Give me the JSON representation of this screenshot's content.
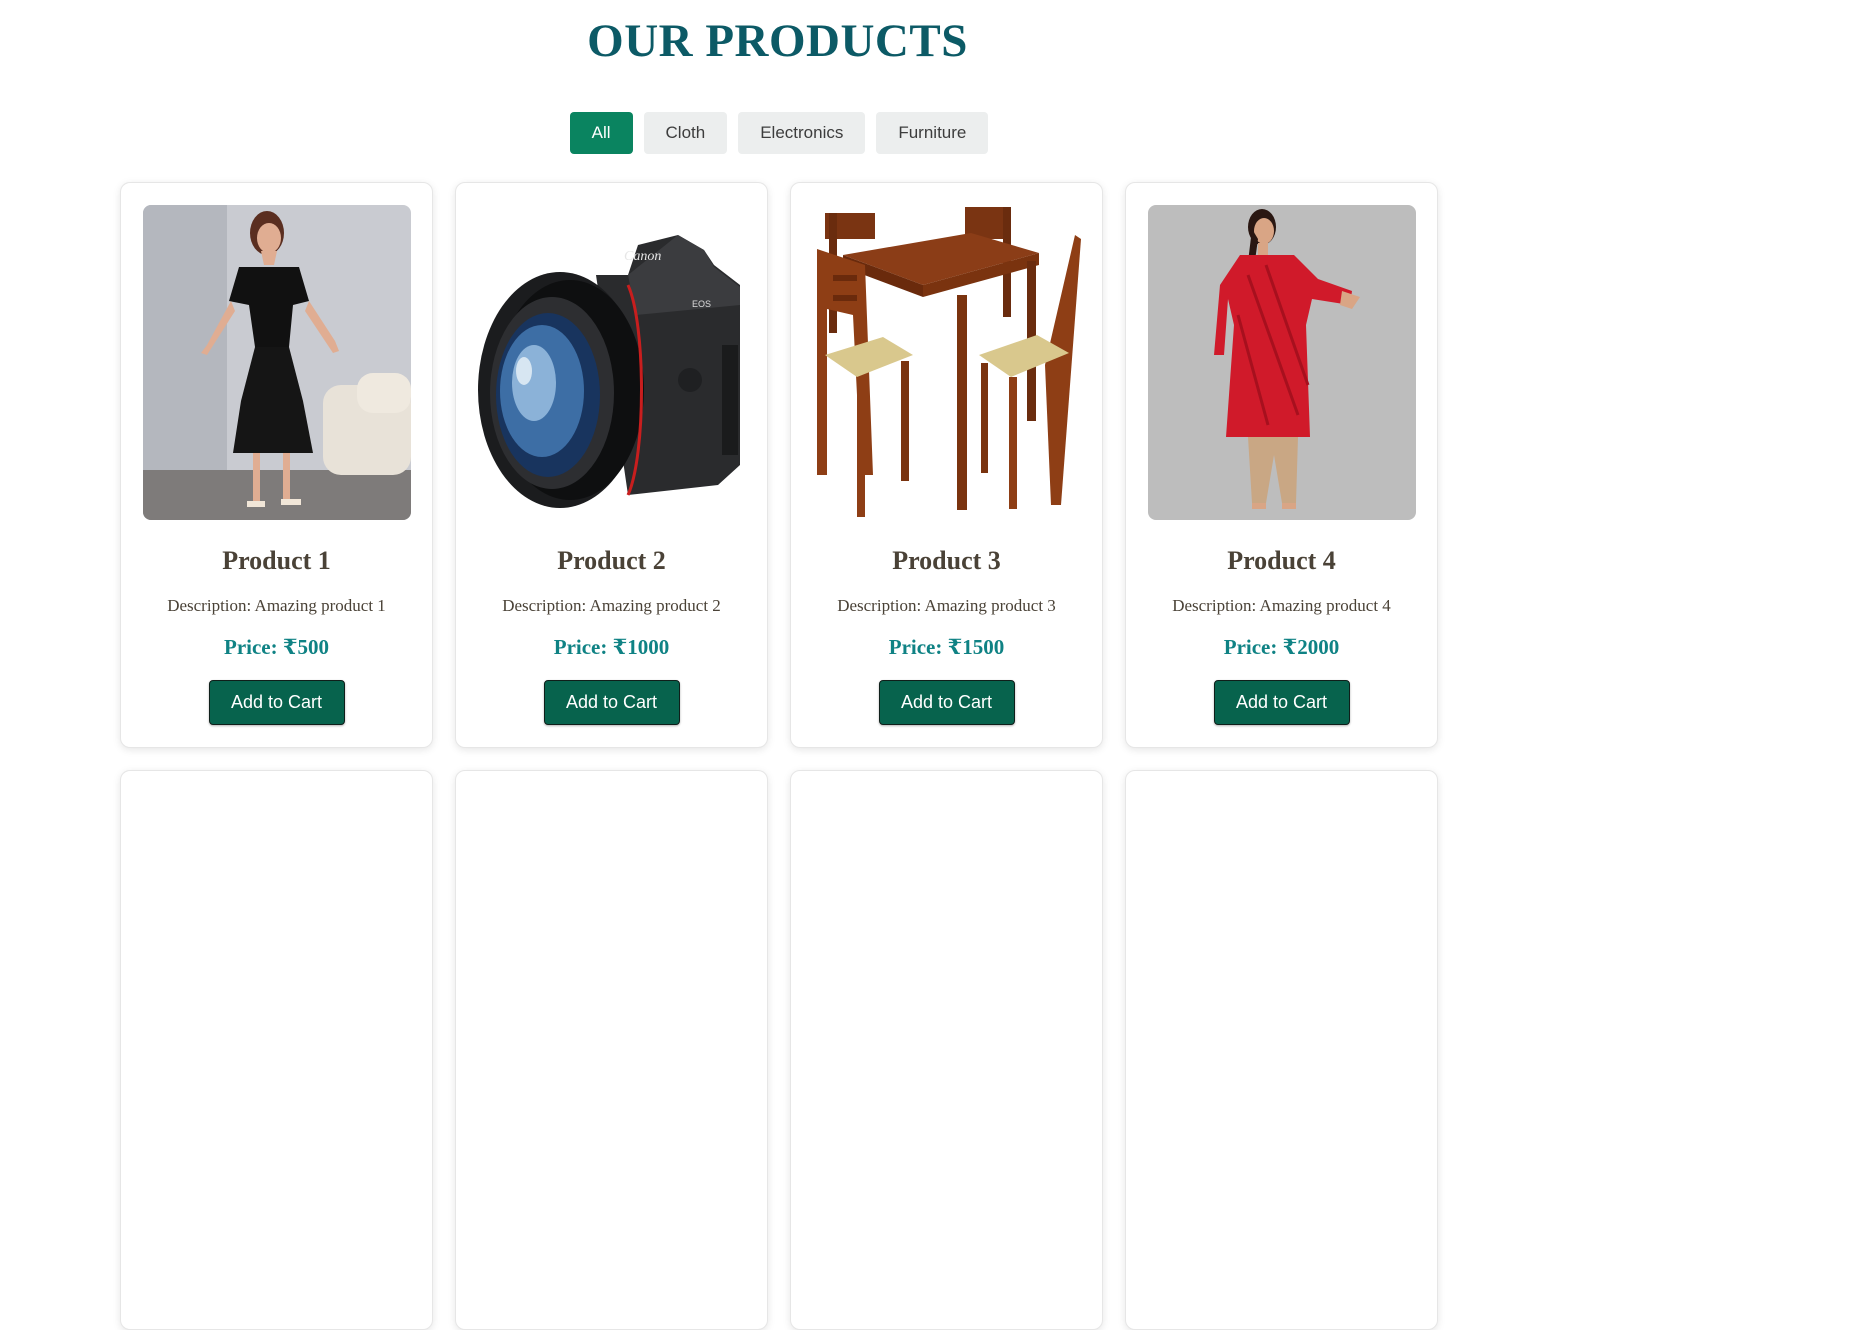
{
  "header": {
    "title": "OUR PRODUCTS"
  },
  "filters": [
    {
      "label": "All",
      "active": true
    },
    {
      "label": "Cloth",
      "active": false
    },
    {
      "label": "Electronics",
      "active": false
    },
    {
      "label": "Furniture",
      "active": false
    }
  ],
  "products": [
    {
      "name": "Product 1",
      "description": "Description: Amazing product 1",
      "price": "Price: ₹500",
      "button": "Add to Cart",
      "image": "black-dress-photo"
    },
    {
      "name": "Product 2",
      "description": "Description: Amazing product 2",
      "price": "Price: ₹1000",
      "button": "Add to Cart",
      "image": "camera-photo"
    },
    {
      "name": "Product 3",
      "description": "Description: Amazing product 3",
      "price": "Price: ₹1500",
      "button": "Add to Cart",
      "image": "dining-table-photo"
    },
    {
      "name": "Product 4",
      "description": "Description: Amazing product 4",
      "price": "Price: ₹2000",
      "button": "Add to Cart",
      "image": "red-kurta-photo"
    }
  ],
  "colors": {
    "title": "#0c5a66",
    "active_filter": "#0a8460",
    "price": "#0f8284",
    "cart_button": "#07634d"
  }
}
